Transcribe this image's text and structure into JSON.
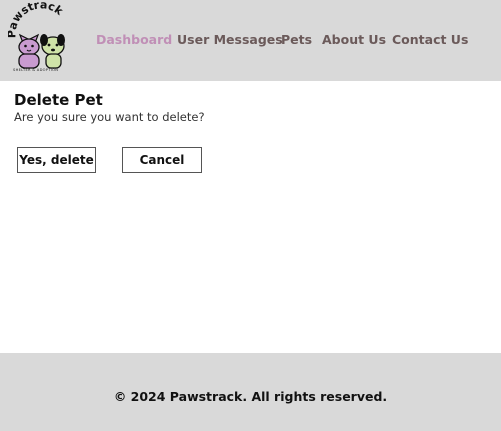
{
  "header": {
    "logo_word": "Pawstrack",
    "logo_tagline": "SHELTER & ADOPTION",
    "nav": [
      {
        "label": "Dashboard",
        "active": true
      },
      {
        "label": "User Messages",
        "active": false
      },
      {
        "label": "Pets",
        "active": false
      },
      {
        "label": "About Us",
        "active": false
      },
      {
        "label": "Contact Us",
        "active": false
      }
    ]
  },
  "main": {
    "title": "Delete Pet",
    "subtitle": "Are you sure you want to delete?",
    "confirm_label": "Yes, delete",
    "cancel_label": "Cancel"
  },
  "footer": {
    "text": "© 2024 Pawstrack. All rights reserved."
  },
  "colors": {
    "header_bg": "#d9d9d9",
    "nav_text": "#6b5a5a",
    "nav_active": "#c08fb6",
    "footer_bg": "#d9d9d9"
  }
}
